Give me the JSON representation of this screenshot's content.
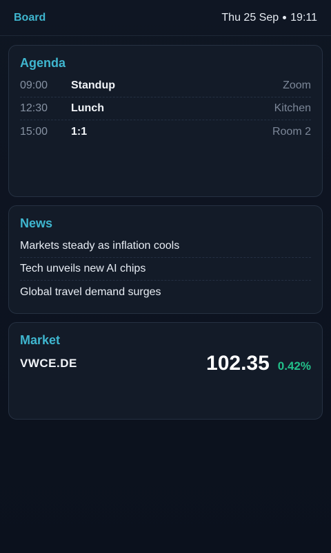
{
  "header": {
    "brand": "Board",
    "date": "Thu 25 Sep",
    "time": "19:11"
  },
  "agenda": {
    "title": "Agenda",
    "items": [
      {
        "time": "09:00",
        "title": "Standup",
        "location": "Zoom"
      },
      {
        "time": "12:30",
        "title": "Lunch",
        "location": "Kitchen"
      },
      {
        "time": "15:00",
        "title": "1:1",
        "location": "Room 2"
      }
    ]
  },
  "news": {
    "title": "News",
    "items": [
      "Markets steady as inflation cools",
      "Tech unveils new AI chips",
      "Global travel demand surges"
    ]
  },
  "market": {
    "title": "Market",
    "ticker": "VWCE.DE",
    "price": "102.35",
    "change": "0.42%"
  },
  "colors": {
    "accent": "#3fb6cf",
    "positive": "#22c08a",
    "background": "#0c1220",
    "card": "#131b28"
  }
}
